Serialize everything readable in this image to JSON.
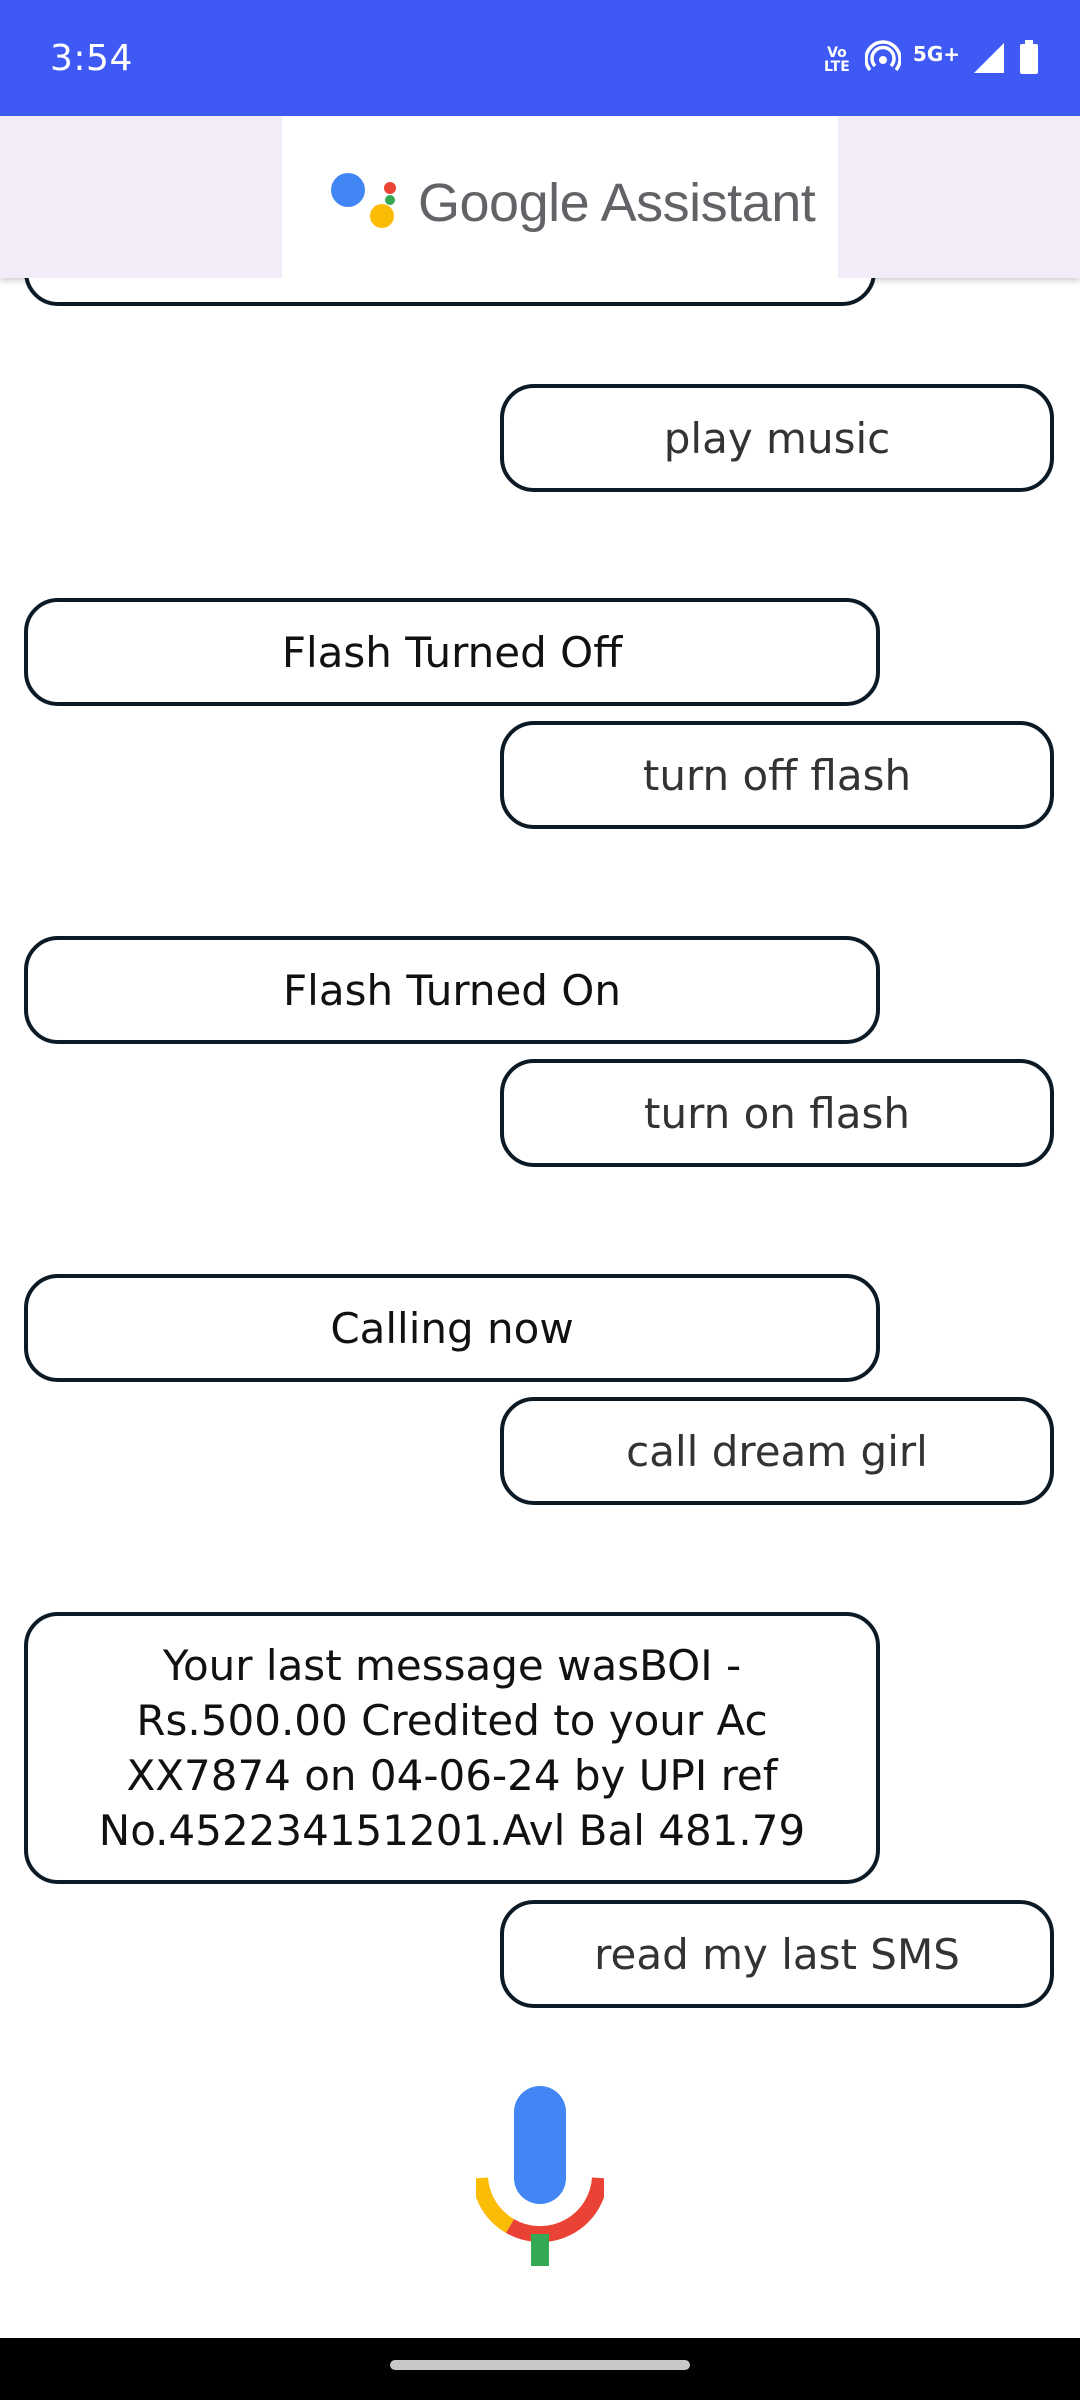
{
  "status_bar": {
    "time": "3:54",
    "network_label": "5G+",
    "volte_label": "Vo LTE",
    "icons": [
      "volte-icon",
      "hotspot-icon",
      "5g-icon",
      "signal-icon",
      "battery-icon"
    ]
  },
  "header": {
    "logo_text": "Google Assistant",
    "logo_colors": [
      "#4285F4",
      "#EA4335",
      "#FBBC05",
      "#34A853"
    ]
  },
  "chat": {
    "messages": [
      {
        "from": "user",
        "text": "play music"
      },
      {
        "from": "assistant",
        "text": "Flash Turned Off"
      },
      {
        "from": "user",
        "text": "turn off flash"
      },
      {
        "from": "assistant",
        "text": "Flash Turned On"
      },
      {
        "from": "user",
        "text": "turn on flash"
      },
      {
        "from": "assistant",
        "text": "Calling now"
      },
      {
        "from": "user",
        "text": "call dream girl"
      },
      {
        "from": "assistant",
        "text": "Your last message wasBOI - Rs.500.00 Credited to your Ac XX7874 on 04-06-24 by UPI ref No.452234151201.Avl Bal 481.79"
      },
      {
        "from": "user",
        "text": "read my last SMS"
      }
    ]
  },
  "mic": {
    "icon": "microphone-icon"
  },
  "colors": {
    "status_bar": "#3f5af4",
    "header_bg": "#f1ecf8",
    "bubble_border": "#0c1a26"
  }
}
